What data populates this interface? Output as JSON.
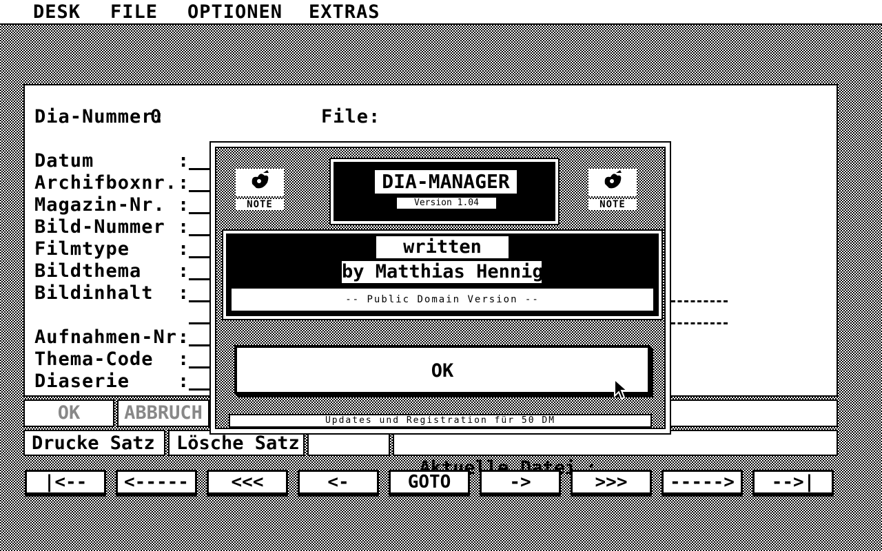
{
  "menu": {
    "desk": "DESK",
    "file": "FILE",
    "optionen": "OPTIONEN",
    "extras": "EXTRAS"
  },
  "form": {
    "dia_nummer_label": "Dia-Nummer:",
    "dia_nummer_value": "0",
    "file_label": "File:",
    "fields": [
      {
        "label": "Datum",
        "sep": ":"
      },
      {
        "label": "Archifboxnr.",
        "sep": ":"
      },
      {
        "label": "Magazin-Nr.",
        "sep": ":"
      },
      {
        "label": "Bild-Nummer",
        "sep": ":"
      },
      {
        "label": "Filmtype",
        "sep": ":"
      },
      {
        "label": "Bildthema",
        "sep": ":"
      },
      {
        "label": "Bildinhalt",
        "sep": ":"
      },
      {
        "label": "Aufnahmen-Nr.",
        "sep": ":"
      },
      {
        "label": "Thema-Code",
        "sep": ":"
      },
      {
        "label": "Diaserie",
        "sep": ":"
      }
    ]
  },
  "buttons": {
    "ok": "OK",
    "abbruch": "ABBRUCH",
    "drucke_satz": "Drucke Satz",
    "loesche_satz": "Lösche Satz",
    "aktuelle_datei": "Aktuelle Datei",
    "aktuelle_datei_sep": ":"
  },
  "nav": [
    "|<--",
    "<-----",
    "<<<",
    "<-",
    "GOTO",
    "->",
    ">>>",
    "----->",
    "-->|"
  ],
  "dialog": {
    "title": "DIA-MANAGER",
    "version": "Version 1.04",
    "written": "written",
    "author": "by Matthias Hennig",
    "pd_version": "-- Public Domain Version --",
    "ok_label": "OK",
    "footer": "Updates und Registration für 50 DM",
    "note_left": "NOTE",
    "note_right": "NOTE",
    "icon_left": "note-icon",
    "icon_right": "note-icon"
  }
}
